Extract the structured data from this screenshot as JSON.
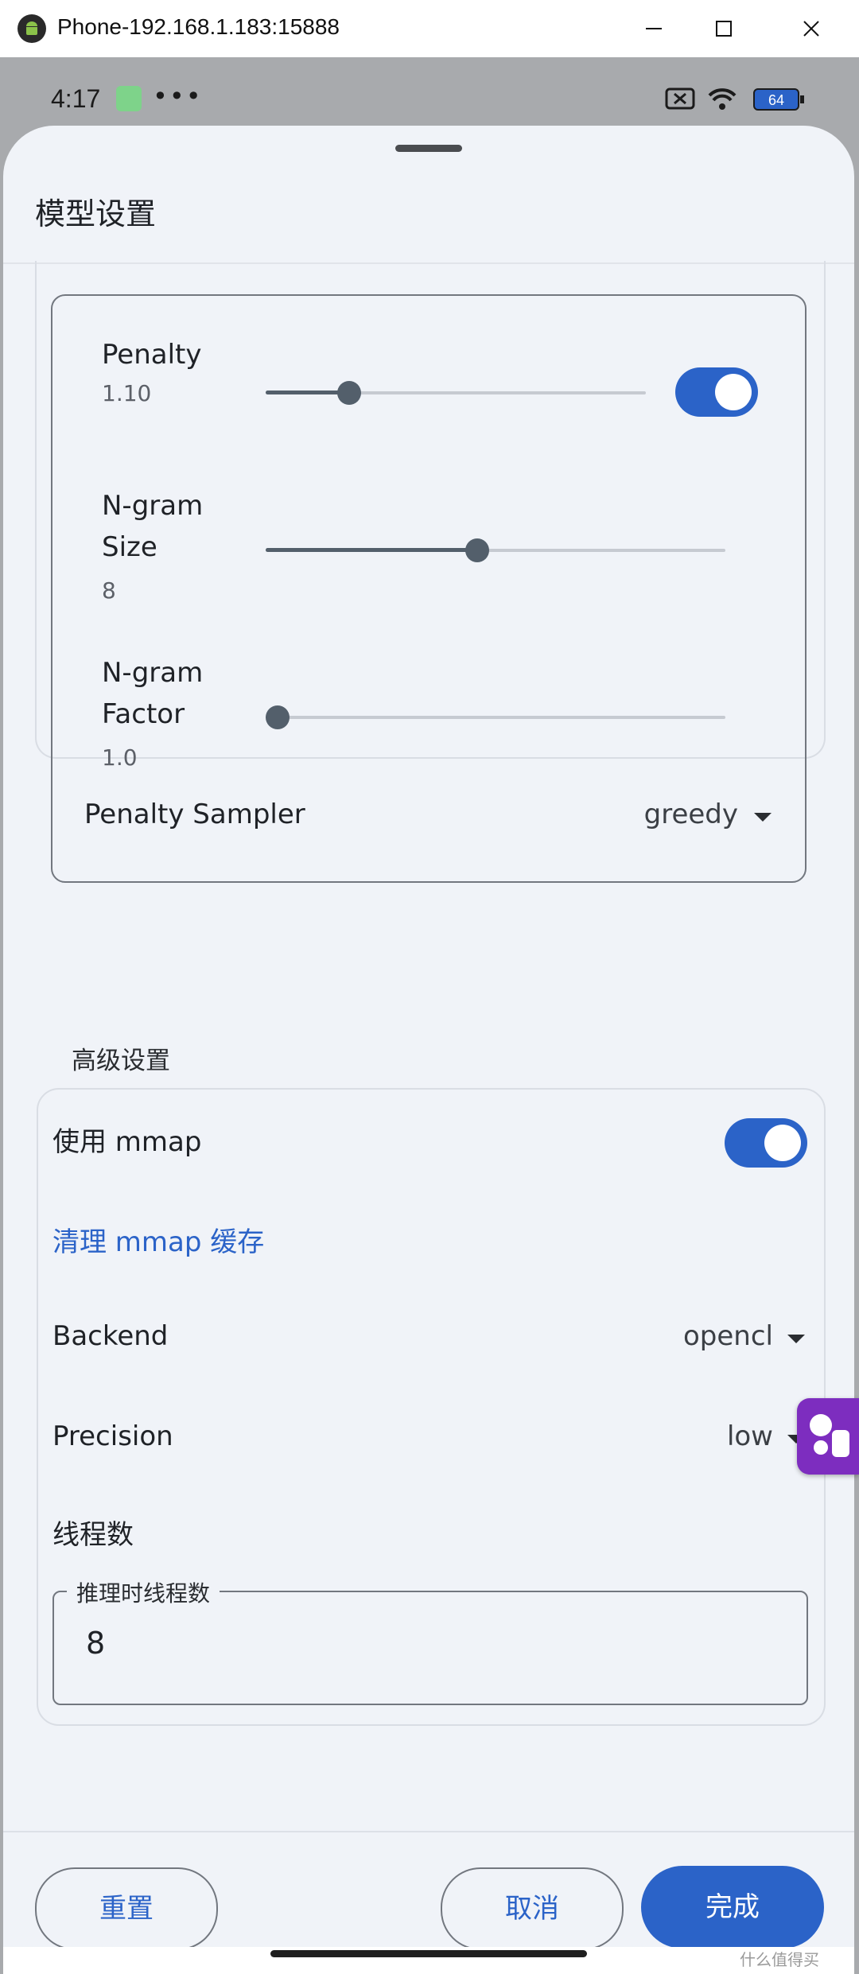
{
  "window": {
    "title": "Phone-192.168.1.183:15888"
  },
  "status_bar": {
    "time": "4:17",
    "dots": "•••",
    "battery": "64"
  },
  "sheet": {
    "title": "模型设置"
  },
  "penalty_card": {
    "penalty": {
      "label": "Penalty",
      "value": "1.10",
      "slider_fraction": 0.22,
      "enabled": true
    },
    "ngram_size": {
      "label_line1": "N-gram",
      "label_line2": "Size",
      "value": "8",
      "slider_fraction": 0.46
    },
    "ngram_factor": {
      "label_line1": "N-gram",
      "label_line2": "Factor",
      "value": "1.0",
      "slider_fraction": 0.0
    },
    "sampler": {
      "label": "Penalty Sampler",
      "selected": "greedy"
    }
  },
  "advanced": {
    "section_title": "高级设置",
    "use_mmap": {
      "label": "使用 mmap",
      "enabled": true
    },
    "clear_mmap_link": "清理 mmap 缓存",
    "backend": {
      "label": "Backend",
      "selected": "opencl"
    },
    "precision": {
      "label": "Precision",
      "selected": "low"
    },
    "threads": {
      "label": "线程数",
      "field_label": "推理时线程数",
      "value": "8"
    }
  },
  "footer": {
    "reset_label": "重置",
    "cancel_label": "取消",
    "done_label": "完成"
  },
  "colors": {
    "accent": "#2b63c8",
    "sheet_bg": "#f0f3f8",
    "slider": "#535f6b"
  },
  "watermark": "什么值得买"
}
